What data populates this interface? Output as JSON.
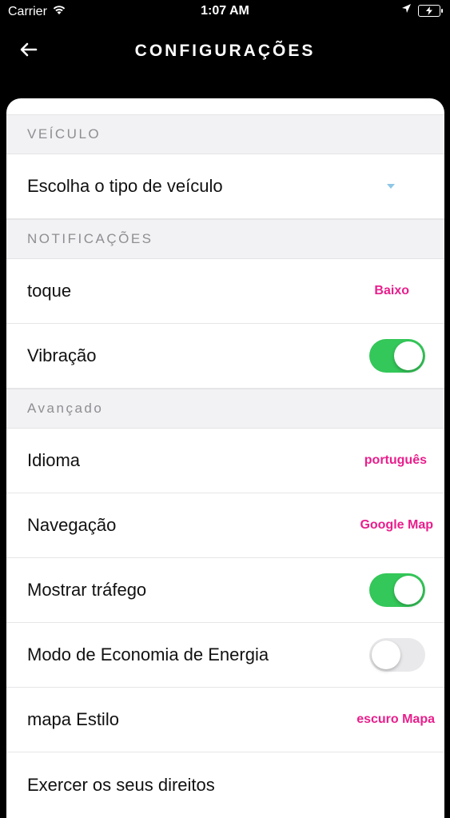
{
  "status_bar": {
    "carrier": "Carrier",
    "time": "1:07 AM",
    "wifi_icon": "wifi-icon",
    "location_icon": "location-arrow-icon",
    "battery_icon": "battery-charging-icon"
  },
  "header": {
    "title": "CONFIGURAÇÕES",
    "back_icon": "arrow-left-icon"
  },
  "sections": {
    "vehicle": {
      "title": "VEÍCULO",
      "vehicle_type": {
        "label": "Escolha o tipo de veículo",
        "icon": "caret-down-icon"
      }
    },
    "notifications": {
      "title": "NOTIFICAÇÕES",
      "ringtone": {
        "label": "toque",
        "value": "Baixo"
      },
      "vibration": {
        "label": "Vibração",
        "enabled": true
      }
    },
    "advanced": {
      "title": "Avançado",
      "language": {
        "label": "Idioma",
        "value": "português"
      },
      "navigation": {
        "label": "Navegação",
        "value": "Google Map"
      },
      "traffic": {
        "label": "Mostrar tráfego",
        "enabled": true
      },
      "power_saving": {
        "label": "Modo de Economia de Energia",
        "enabled": false
      },
      "map_style": {
        "label": "mapa Estilo",
        "value": "escuro Mapa"
      },
      "rights": {
        "label": "Exercer os seus direitos"
      }
    }
  },
  "colors": {
    "accent": "#e91e8c",
    "toggle_on": "#34c759",
    "toggle_off": "#e9e9eb",
    "section_bg": "#f2f2f4"
  }
}
